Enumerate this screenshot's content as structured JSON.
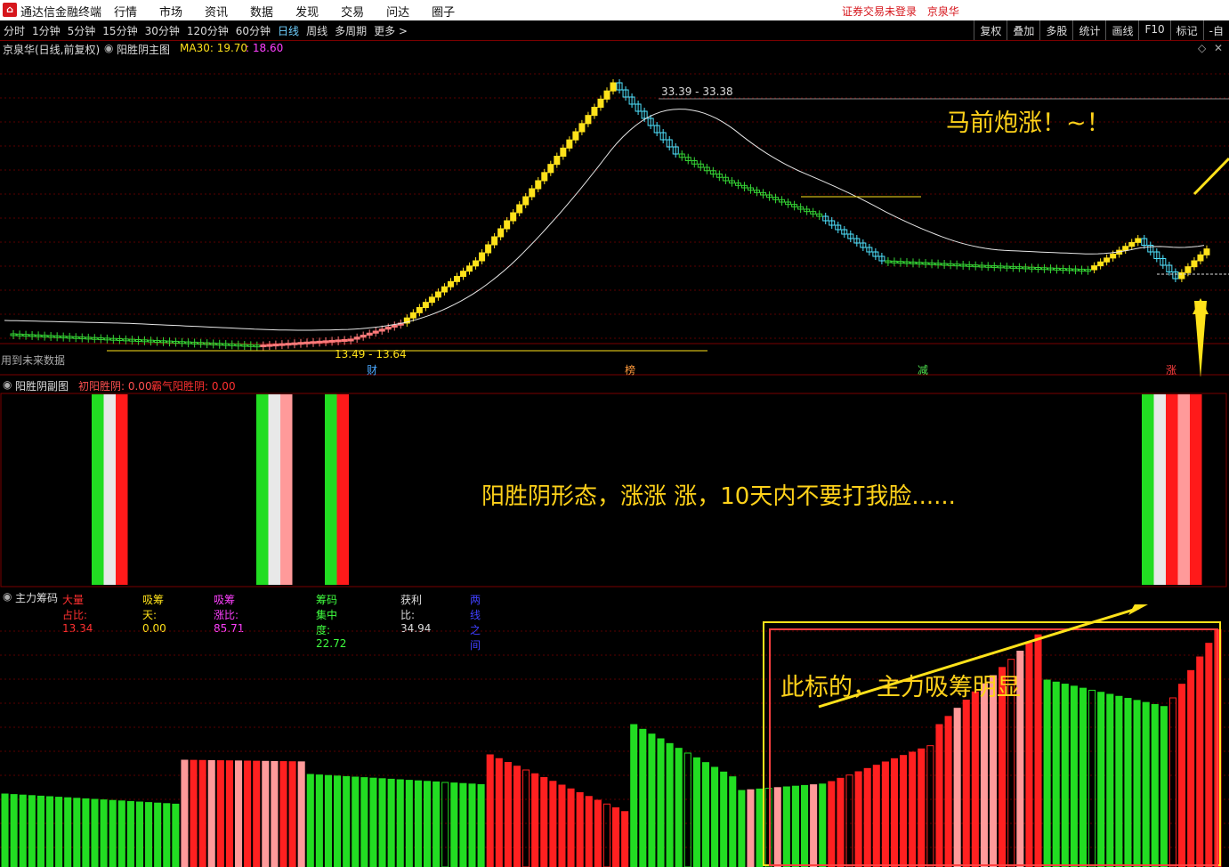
{
  "menubar": {
    "app_title": "通达信金融终端",
    "menus": [
      "行情",
      "市场",
      "资讯",
      "数据",
      "发现",
      "交易",
      "问达",
      "圈子"
    ],
    "login_status": "证券交易未登录",
    "stock_name": "京泉华"
  },
  "toolbar": {
    "periods": [
      "分时",
      "1分钟",
      "5分钟",
      "15分钟",
      "30分钟",
      "120分钟",
      "60分钟",
      "日线",
      "周线",
      "多周期",
      "更多 >"
    ],
    "active_period": "日线",
    "tools": [
      "复权",
      "叠加",
      "多股",
      "统计",
      "画线",
      "F10",
      "标记",
      "-自"
    ]
  },
  "main_chart": {
    "title": "京泉华(日线,前复权)",
    "indicator": "阳胜阴主图",
    "ma_label": "MA30: 19.70",
    "ma_extra": ": 18.60",
    "peak_label": "33.39 - 33.38",
    "low_label": "13.49 - 13.64",
    "future_note": "用到未来数据",
    "markers": [
      {
        "text": "财",
        "color": "#4aa8ff"
      },
      {
        "text": "榜",
        "color": "#ff9a3c"
      },
      {
        "text": "减",
        "color": "#4ee04e"
      },
      {
        "text": "涨",
        "color": "#ff4040"
      }
    ],
    "annotation": "马前炮涨！~！",
    "colors": {
      "up_yellow": "#ffe21a",
      "down_cyan": "#4fe3ff",
      "up_pink": "#ff7a7a",
      "down_green": "#35d535",
      "ma": "#e6e6e6"
    }
  },
  "sub_chart": {
    "title": "阳胜阴副图",
    "label1": "初阳胜阴: 0.00",
    "label2": "霸气阳胜阴: 0.00",
    "annotation": "阳胜阴形态，涨涨 涨，10天内不要打我脸......"
  },
  "chip_chart": {
    "title": "主力筹码",
    "labels": [
      {
        "text": "大量占比: 13.34",
        "color": "#ff3030"
      },
      {
        "text": "吸筹天: 0.00",
        "color": "#ffe21a"
      },
      {
        "text": "吸筹涨比: 85.71",
        "color": "#ff40ff"
      },
      {
        "text": "筹码集中度: 22.72",
        "color": "#40ff40"
      },
      {
        "text": "获利比: 34.94",
        "color": "#dddddd"
      },
      {
        "text": "两线之间",
        "color": "#4040ff"
      }
    ],
    "annotation": "此标的，主力吸筹明显"
  }
}
